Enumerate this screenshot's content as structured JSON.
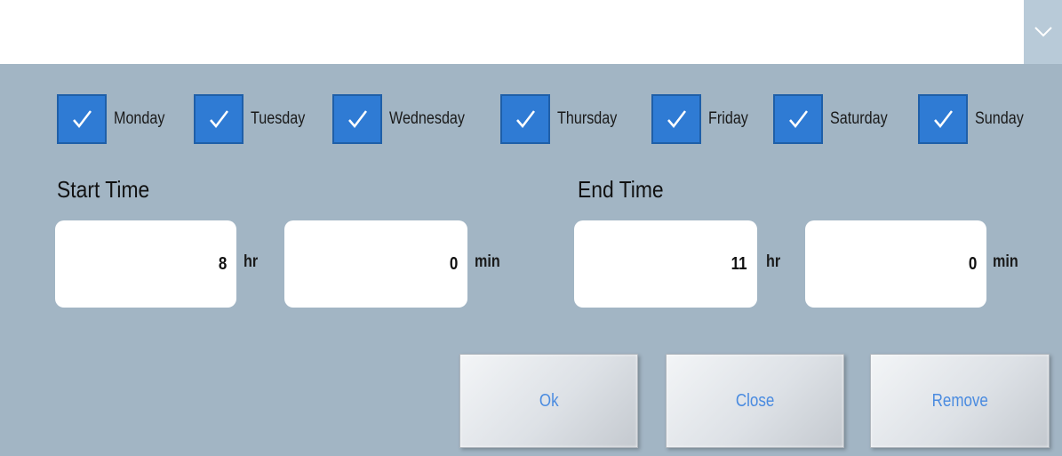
{
  "dropdown": {
    "selected_value": "",
    "arrow_icon": "chevron-down-icon"
  },
  "days": [
    {
      "label": "Monday",
      "checked": true,
      "icon": "checkmark-icon"
    },
    {
      "label": "Tuesday",
      "checked": true,
      "icon": "checkmark-icon"
    },
    {
      "label": "Wednesday",
      "checked": true,
      "icon": "checkmark-icon"
    },
    {
      "label": "Thursday",
      "checked": true,
      "icon": "checkmark-icon"
    },
    {
      "label": "Friday",
      "checked": true,
      "icon": "checkmark-icon"
    },
    {
      "label": "Saturday",
      "checked": true,
      "icon": "checkmark-icon"
    },
    {
      "label": "Sunday",
      "checked": true,
      "icon": "checkmark-icon"
    }
  ],
  "start_time": {
    "label": "Start Time",
    "hours": "8",
    "hours_unit": "hr",
    "minutes": "0",
    "minutes_unit": "min"
  },
  "end_time": {
    "label": "End Time",
    "hours": "11",
    "hours_unit": "hr",
    "minutes": "0",
    "minutes_unit": "min"
  },
  "buttons": {
    "ok_label": "Ok",
    "close_label": "Close",
    "remove_label": "Remove"
  },
  "colors": {
    "background": "#a2b5c4",
    "checkbox": "#2f7bd4",
    "button_text": "#4a8be0"
  }
}
